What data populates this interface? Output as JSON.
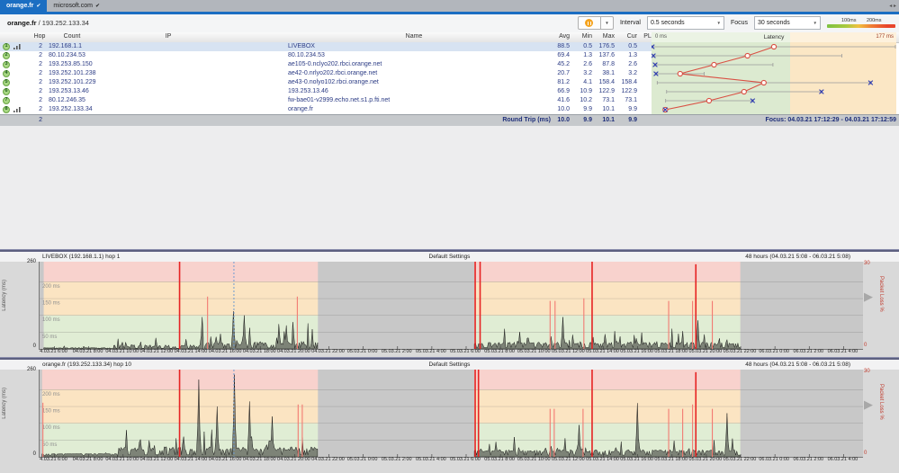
{
  "icons": {
    "caret": "▼",
    "expander": "▶",
    "tab_scroll": "◂ ▸",
    "check": "✔"
  },
  "colors": {
    "accent": "#1b6ec2",
    "selected_row_bg": "#d7e3f2",
    "hop_circle_fill": "#a8d783",
    "zone_green": "#dcead0",
    "zone_tan": "#fbe7c5",
    "band_green": "#e0edd4",
    "band_orange": "#fbe4c2",
    "band_red": "#f8d2cd",
    "band_inactive": "#c8c8c8",
    "loss_spike_major": "#e62323",
    "loss_spike_minor": "#f27a72",
    "avg_marker": "#d94f43",
    "cur_marker": "#2d3bb3",
    "range_line": "#9a9a9a",
    "trace": "#1a1a1a",
    "focus_line": "#6f9bd1"
  },
  "tabs": {
    "items": [
      {
        "label": "orange.fr",
        "active": true
      },
      {
        "label": "microsoft.com",
        "active": false
      }
    ]
  },
  "toolbar": {
    "breadcrumb_host": "orange.fr",
    "breadcrumb_sep": " / ",
    "breadcrumb_ip": "193.252.133.34",
    "interval_label": "Interval",
    "interval_value": "0.5 seconds",
    "focus_label": "Focus",
    "focus_value": "30 seconds",
    "legend_100": "100ms",
    "legend_200": "200ms"
  },
  "trace_table": {
    "headers": {
      "hop": "Hop",
      "count": "Count",
      "ip": "IP",
      "name": "Name",
      "avg": "Avg",
      "min": "Min",
      "max": "Max",
      "cur": "Cur",
      "pl": "PL%"
    },
    "latency_header": {
      "left": "0 ms",
      "center": "Latency",
      "right": "177 ms"
    },
    "scale": {
      "max_ms": 177,
      "green_max_ms": 100
    },
    "rows": [
      {
        "hop": "1",
        "count": "2",
        "ip": "192.168.1.1",
        "name": "LIVEBOX",
        "avg": "88.5",
        "min": "0.5",
        "max": "176.5",
        "cur": "0.5",
        "pl": "",
        "graph_open": true,
        "selected": true
      },
      {
        "hop": "2",
        "count": "2",
        "ip": "80.10.234.53",
        "name": "80.10.234.53",
        "avg": "69.4",
        "min": "1.3",
        "max": "137.6",
        "cur": "1.3",
        "pl": "",
        "graph_open": false,
        "selected": false
      },
      {
        "hop": "3",
        "count": "2",
        "ip": "193.253.85.150",
        "name": "ae105-0.nclyo202.rbci.orange.net",
        "avg": "45.2",
        "min": "2.6",
        "max": "87.8",
        "cur": "2.6",
        "pl": "",
        "graph_open": false,
        "selected": false
      },
      {
        "hop": "4",
        "count": "2",
        "ip": "193.252.101.238",
        "name": "ae42-0.nrlyo202.rbci.orange.net",
        "avg": "20.7",
        "min": "3.2",
        "max": "38.1",
        "cur": "3.2",
        "pl": "",
        "graph_open": false,
        "selected": false
      },
      {
        "hop": "5",
        "count": "2",
        "ip": "193.252.101.229",
        "name": "ae43-0.nolyo102.rbci.orange.net",
        "avg": "81.2",
        "min": "4.1",
        "max": "158.4",
        "cur": "158.4",
        "pl": "",
        "graph_open": false,
        "selected": false
      },
      {
        "hop": "6",
        "count": "2",
        "ip": "193.253.13.46",
        "name": "193.253.13.46",
        "avg": "66.9",
        "min": "10.9",
        "max": "122.9",
        "cur": "122.9",
        "pl": "",
        "graph_open": false,
        "selected": false
      },
      {
        "hop": "7",
        "count": "2",
        "ip": "80.12.246.35",
        "name": "fw-bae01-v2999.echo.net.s1.p.fti.net",
        "avg": "41.6",
        "min": "10.2",
        "max": "73.1",
        "cur": "73.1",
        "pl": "",
        "graph_open": false,
        "selected": false
      },
      {
        "hop": "8",
        "count": "2",
        "ip": "193.252.133.34",
        "name": "orange.fr",
        "avg": "10.0",
        "min": "9.9",
        "max": "10.1",
        "cur": "9.9",
        "pl": "",
        "graph_open": true,
        "selected": false
      }
    ],
    "summary": {
      "count": "2",
      "label": "Round Trip (ms)",
      "avg": "10.0",
      "min": "9.9",
      "max": "10.1",
      "cur": "9.9",
      "focus": "Focus: 04.03.21 17:12:29 - 04.03.21 17:12:59"
    }
  },
  "chart_data": [
    {
      "type": "line",
      "title": "LIVEBOX (192.168.1.1) hop 1",
      "settings_label": "Default Settings",
      "range_label": "48 hours (04.03.21 5:08 - 06.03.21 5:08)",
      "ylabel": "Latency (ms)",
      "ylim": [
        0,
        260
      ],
      "y_ticks": [
        "260",
        "0"
      ],
      "right_axis_label": "Packet Loss %",
      "right_ylim": [
        0,
        30
      ],
      "right_ticks": [
        "30",
        "0"
      ],
      "gridlines": [
        {
          "ms": 200,
          "label": "200 ms"
        },
        {
          "ms": 150,
          "label": "150 ms"
        },
        {
          "ms": 100,
          "label": "100 ms"
        },
        {
          "ms": 50,
          "label": "50 ms"
        }
      ],
      "x_ticks": [
        "4.03.21 6:00",
        "04.03.21 8:00",
        "04.03.21 10:00",
        "04.03.21 12:00",
        "04.03.21 14:00",
        "04.03.21 16:00",
        "04.03.21 18:00",
        "04.03.21 20:00",
        "04.03.21 22:00",
        "05.03.21 0:00",
        "05.03.21 2:00",
        "05.03.21 4:00",
        "05.03.21 6:00",
        "05.03.21 8:00",
        "05.03.21 10:00",
        "05.03.21 12:00",
        "05.03.21 14:00",
        "05.03.21 16:00",
        "05.03.21 18:00",
        "05.03.21 20:00",
        "05.03.21 22:00",
        "06.03.21 0:00",
        "06.03.21 2:00",
        "06.03.21 4:00"
      ],
      "x_tick_start_frac": 0.018,
      "x_tick_step_frac": 0.04167,
      "bands_ms": {
        "green": [
          0,
          100
        ],
        "orange": [
          100,
          200
        ],
        "red": [
          200,
          260
        ]
      },
      "active_regions": [
        [
          0.005,
          0.338
        ],
        [
          0.528,
          0.851
        ]
      ],
      "focus_line_frac": 0.236,
      "loss_spikes": [
        {
          "x": 0.17,
          "h": 1.0
        },
        {
          "x": 0.204,
          "h": 0.6
        },
        {
          "x": 0.313,
          "h": 0.6
        },
        {
          "x": 0.529,
          "h": 1.0
        },
        {
          "x": 0.535,
          "h": 1.0
        },
        {
          "x": 0.62,
          "h": 0.55
        },
        {
          "x": 0.626,
          "h": 0.55
        },
        {
          "x": 0.661,
          "h": 0.58
        },
        {
          "x": 0.671,
          "h": 1.0
        },
        {
          "x": 0.764,
          "h": 0.55
        },
        {
          "x": 0.793,
          "h": 0.55
        },
        {
          "x": 0.797,
          "h": 0.97
        },
        {
          "x": 0.817,
          "h": 0.55
        }
      ],
      "trace_segments": [
        {
          "from": 0.005,
          "to": 0.09,
          "base": 2,
          "amp": 6
        },
        {
          "from": 0.09,
          "to": 0.2,
          "base": 4,
          "amp": 28
        },
        {
          "from": 0.2,
          "to": 0.338,
          "base": 6,
          "amp": 55
        },
        {
          "from": 0.528,
          "to": 0.851,
          "base": 8,
          "amp": 42
        }
      ],
      "trace_peaks": [
        {
          "x": 0.198,
          "ms": 95
        },
        {
          "x": 0.235,
          "ms": 112
        },
        {
          "x": 0.249,
          "ms": 100
        },
        {
          "x": 0.3,
          "ms": 70
        },
        {
          "x": 0.635,
          "ms": 95
        },
        {
          "x": 0.8,
          "ms": 85
        }
      ],
      "seed": 11
    },
    {
      "type": "line",
      "title": "orange.fr (193.252.133.34) hop 10",
      "settings_label": "Default Settings",
      "range_label": "48 hours (04.03.21 5:08 - 06.03.21 5:08)",
      "ylabel": "Latency (ms)",
      "ylim": [
        0,
        260
      ],
      "y_ticks": [
        "260",
        "0"
      ],
      "right_axis_label": "Packet Loss %",
      "right_ylim": [
        0,
        30
      ],
      "right_ticks": [
        "30",
        "0"
      ],
      "gridlines": [
        {
          "ms": 200,
          "label": "200 ms"
        },
        {
          "ms": 150,
          "label": "150 ms"
        },
        {
          "ms": 100,
          "label": "100 ms"
        },
        {
          "ms": 50,
          "label": "50 ms"
        }
      ],
      "x_ticks": [
        "4.03.21 6:00",
        "04.03.21 8:00",
        "04.03.21 10:00",
        "04.03.21 12:00",
        "04.03.21 14:00",
        "04.03.21 16:00",
        "04.03.21 18:00",
        "04.03.21 20:00",
        "04.03.21 22:00",
        "05.03.21 0:00",
        "05.03.21 2:00",
        "05.03.21 4:00",
        "05.03.21 6:00",
        "05.03.21 8:00",
        "05.03.21 10:00",
        "05.03.21 12:00",
        "05.03.21 14:00",
        "05.03.21 16:00",
        "05.03.21 18:00",
        "05.03.21 20:00",
        "05.03.21 22:00",
        "06.03.21 0:00",
        "06.03.21 2:00",
        "06.03.21 4:00"
      ],
      "x_tick_start_frac": 0.018,
      "x_tick_step_frac": 0.04167,
      "bands_ms": {
        "green": [
          0,
          100
        ],
        "orange": [
          100,
          200
        ],
        "red": [
          200,
          260
        ]
      },
      "active_regions": [
        [
          0.003,
          0.338
        ],
        [
          0.528,
          0.851
        ]
      ],
      "focus_line_frac": 0.236,
      "loss_spikes": [
        {
          "x": 0.004,
          "h": 0.62
        },
        {
          "x": 0.17,
          "h": 1.0
        },
        {
          "x": 0.314,
          "h": 0.6
        },
        {
          "x": 0.319,
          "h": 0.6
        },
        {
          "x": 0.529,
          "h": 1.0
        },
        {
          "x": 0.533,
          "h": 1.0
        },
        {
          "x": 0.62,
          "h": 0.55
        },
        {
          "x": 0.625,
          "h": 0.55
        },
        {
          "x": 0.66,
          "h": 0.55
        },
        {
          "x": 0.671,
          "h": 1.0
        },
        {
          "x": 0.764,
          "h": 0.55
        },
        {
          "x": 0.781,
          "h": 0.55
        },
        {
          "x": 0.793,
          "h": 0.6
        },
        {
          "x": 0.797,
          "h": 0.97
        },
        {
          "x": 0.817,
          "h": 0.55
        }
      ],
      "trace_segments": [
        {
          "from": 0.003,
          "to": 0.095,
          "base": 8,
          "amp": 4
        },
        {
          "from": 0.095,
          "to": 0.338,
          "base": 12,
          "amp": 60
        },
        {
          "from": 0.528,
          "to": 0.851,
          "base": 10,
          "amp": 38
        }
      ],
      "trace_peaks": [
        {
          "x": 0.193,
          "ms": 230
        },
        {
          "x": 0.215,
          "ms": 150
        },
        {
          "x": 0.237,
          "ms": 245
        },
        {
          "x": 0.255,
          "ms": 165
        },
        {
          "x": 0.283,
          "ms": 120
        },
        {
          "x": 0.655,
          "ms": 95
        },
        {
          "x": 0.726,
          "ms": 160
        },
        {
          "x": 0.835,
          "ms": 130
        }
      ],
      "seed": 29
    }
  ]
}
